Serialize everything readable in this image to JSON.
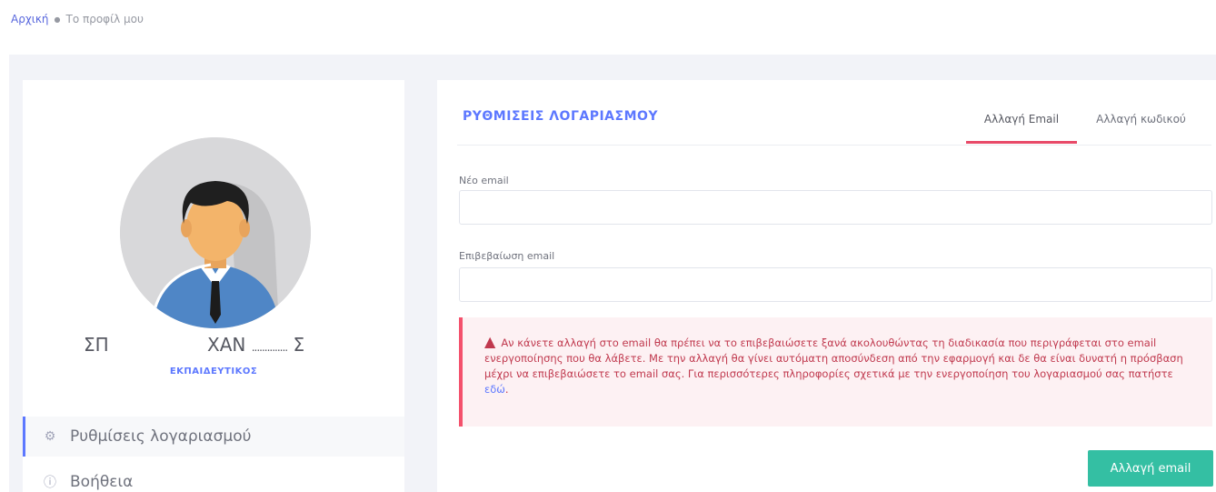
{
  "breadcrumb": {
    "home": "Αρχική",
    "current": "Το προφίλ μου"
  },
  "profile": {
    "name_first": "ΣΠ",
    "name_last_start": "ΧΑΝ",
    "name_dots": "..............",
    "name_last_end": "Σ",
    "role": "ΕΚΠΑΙΔΕΥΤΙΚΟΣ",
    "menu": [
      {
        "label": "Ρυθμίσεις λογαριασμού",
        "icon": "gear-icon",
        "active": true
      },
      {
        "label": "Βοήθεια",
        "icon": "info-icon",
        "active": false
      }
    ]
  },
  "settings": {
    "title": "ΡΥΘΜΙΣΕΙΣ ΛΟΓΑΡΙΑΣΜΟΥ",
    "tabs": [
      {
        "label": "Αλλαγή Email",
        "active": true
      },
      {
        "label": "Αλλαγή κωδικού",
        "active": false
      }
    ],
    "new_email_label": "Νέο email",
    "new_email_value": "",
    "confirm_email_label": "Επιβεβαίωση email",
    "confirm_email_value": "",
    "alert_text": "Αν κάνετε αλλαγή στο email θα πρέπει να το επιβεβαιώσετε ξανά ακολουθώντας τη διαδικασία που περιγράφεται στο email ενεργοποίησης που θα λάβετε. Με την αλλαγή θα γίνει αυτόματη αποσύνδεση από την εφαρμογή και δε θα είναι δυνατή η πρόσβαση μέχρι να επιβεβαιώσετε το email σας. Για περισσότερες πληροφορίες σχετικά με την ενεργοποίηση του λογαριασμού σας πατήστε",
    "alert_link": "εδώ",
    "alert_end": ".",
    "submit_label": "Αλλαγή email"
  },
  "colors": {
    "accent": "#5d78ff",
    "tab_underline": "#e84a68",
    "alert_border": "#f4516c",
    "alert_bg": "#fdf1f3",
    "success": "#34bfa3"
  }
}
